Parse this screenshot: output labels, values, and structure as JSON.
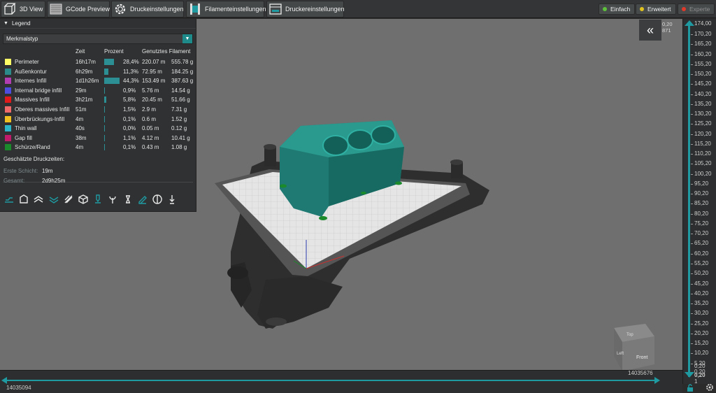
{
  "toolbar": {
    "buttons": [
      {
        "label": "3D View",
        "icon": "cube-icon"
      },
      {
        "label": "GCode Preview",
        "icon": "layers-icon"
      },
      {
        "label": "Druckeinstellungen",
        "icon": "gear-icon"
      },
      {
        "label": "Filamenteinstellungen",
        "icon": "filament-spool-icon"
      },
      {
        "label": "Druckereinstellungen",
        "icon": "printer-icon"
      }
    ],
    "modes": [
      {
        "label": "Einfach",
        "dot_color": "#5ec13b"
      },
      {
        "label": "Erweitert",
        "dot_color": "#e0c21f"
      },
      {
        "label": "Experte",
        "dot_color": "#e03a2a",
        "disabled": true
      }
    ]
  },
  "legend": {
    "title": "Legend",
    "feature_type": "Merkmalstyp",
    "columns": {
      "time": "Zeit",
      "percent": "Prozent",
      "used_filament": "Genutztes Filament"
    },
    "rows": [
      {
        "name": "Perimeter",
        "color": "#ffff66",
        "time": "16h17m",
        "percent": "28,4%",
        "percent_value": 28.4,
        "length": "220.07 m",
        "weight": "555.78 g"
      },
      {
        "name": "Außenkontur",
        "color": "#2b8a8a",
        "time": "6h29m",
        "percent": "11,3%",
        "percent_value": 11.3,
        "length": "72.95 m",
        "weight": "184.25 g"
      },
      {
        "name": "Internes Infill",
        "color": "#b23cb2",
        "time": "1d1h26m",
        "percent": "44,3%",
        "percent_value": 44.3,
        "length": "153.49 m",
        "weight": "387.63 g"
      },
      {
        "name": "Internal bridge infill",
        "color": "#4d4de0",
        "time": "29m",
        "percent": "0,9%",
        "percent_value": 0.9,
        "length": "5.76 m",
        "weight": "14.54 g"
      },
      {
        "name": "Massives Infill",
        "color": "#e01a1a",
        "time": "3h21m",
        "percent": "5,8%",
        "percent_value": 5.8,
        "length": "20.45 m",
        "weight": "51.66 g"
      },
      {
        "name": "Oberes massives Infill",
        "color": "#f06a6a",
        "time": "51m",
        "percent": "1,5%",
        "percent_value": 1.5,
        "length": "2.9 m",
        "weight": "7.31 g"
      },
      {
        "name": "Überbrückungs-Infill",
        "color": "#f0c020",
        "time": "4m",
        "percent": "0,1%",
        "percent_value": 0.1,
        "length": "0.6 m",
        "weight": "1.52 g"
      },
      {
        "name": "Thin wall",
        "color": "#2bb5c8",
        "time": "40s",
        "percent": "0,0%",
        "percent_value": 0.0,
        "length": "0.05 m",
        "weight": "0.12 g"
      },
      {
        "name": "Gap fill",
        "color": "#c01a6a",
        "time": "38m",
        "percent": "1,1%",
        "percent_value": 1.1,
        "length": "4.12 m",
        "weight": "10.41 g"
      },
      {
        "name": "Schürze/Rand",
        "color": "#1a8a2a",
        "time": "4m",
        "percent": "0,1%",
        "percent_value": 0.1,
        "length": "0.43 m",
        "weight": "1.08 g"
      }
    ],
    "estimated_title": "Geschätzte Druckzeiten:",
    "first_layer_label": "Erste Schicht:",
    "first_layer_value": "19m",
    "total_label": "Gesamt:",
    "total_value": "2d9h25m",
    "tool_icons": [
      "bed-icon",
      "shells-icon",
      "layers-up-icon",
      "layers-down-icon",
      "wipe-icon",
      "cube-wireframe-icon",
      "extruder-icon",
      "color-change-icon",
      "pause-icon",
      "custom-gcode-icon",
      "seam-icon",
      "retraction-icon"
    ]
  },
  "layer_slider": {
    "top_value": "174,00",
    "info_line1": "0,20",
    "info_line2": "871",
    "ticks": [
      "170,20",
      "165,20",
      "160,20",
      "155,20",
      "150,20",
      "145,20",
      "140,20",
      "135,20",
      "130,20",
      "125,20",
      "120,20",
      "115,20",
      "110,20",
      "105,20",
      "100,20",
      "95,20",
      "90,20",
      "85,20",
      "80,20",
      "75,20",
      "70,20",
      "65,20",
      "60,20",
      "55,20",
      "50,20",
      "45,20",
      "40,20",
      "35,20",
      "30,20",
      "25,20",
      "20,20",
      "15,20",
      "10,20",
      "5,20"
    ],
    "bottom_values": [
      "0,20",
      "0,20"
    ],
    "bottom_value": "0,20",
    "bottom_index": "1"
  },
  "move_slider": {
    "left_value": "14035094",
    "right_value": "14035676"
  },
  "view_cube": {
    "labels": [
      "Top",
      "Front",
      "Left"
    ]
  },
  "colors": {
    "accent": "#1f9aa1",
    "panel": "#2f3132",
    "viewport": "#6f6f6f"
  }
}
